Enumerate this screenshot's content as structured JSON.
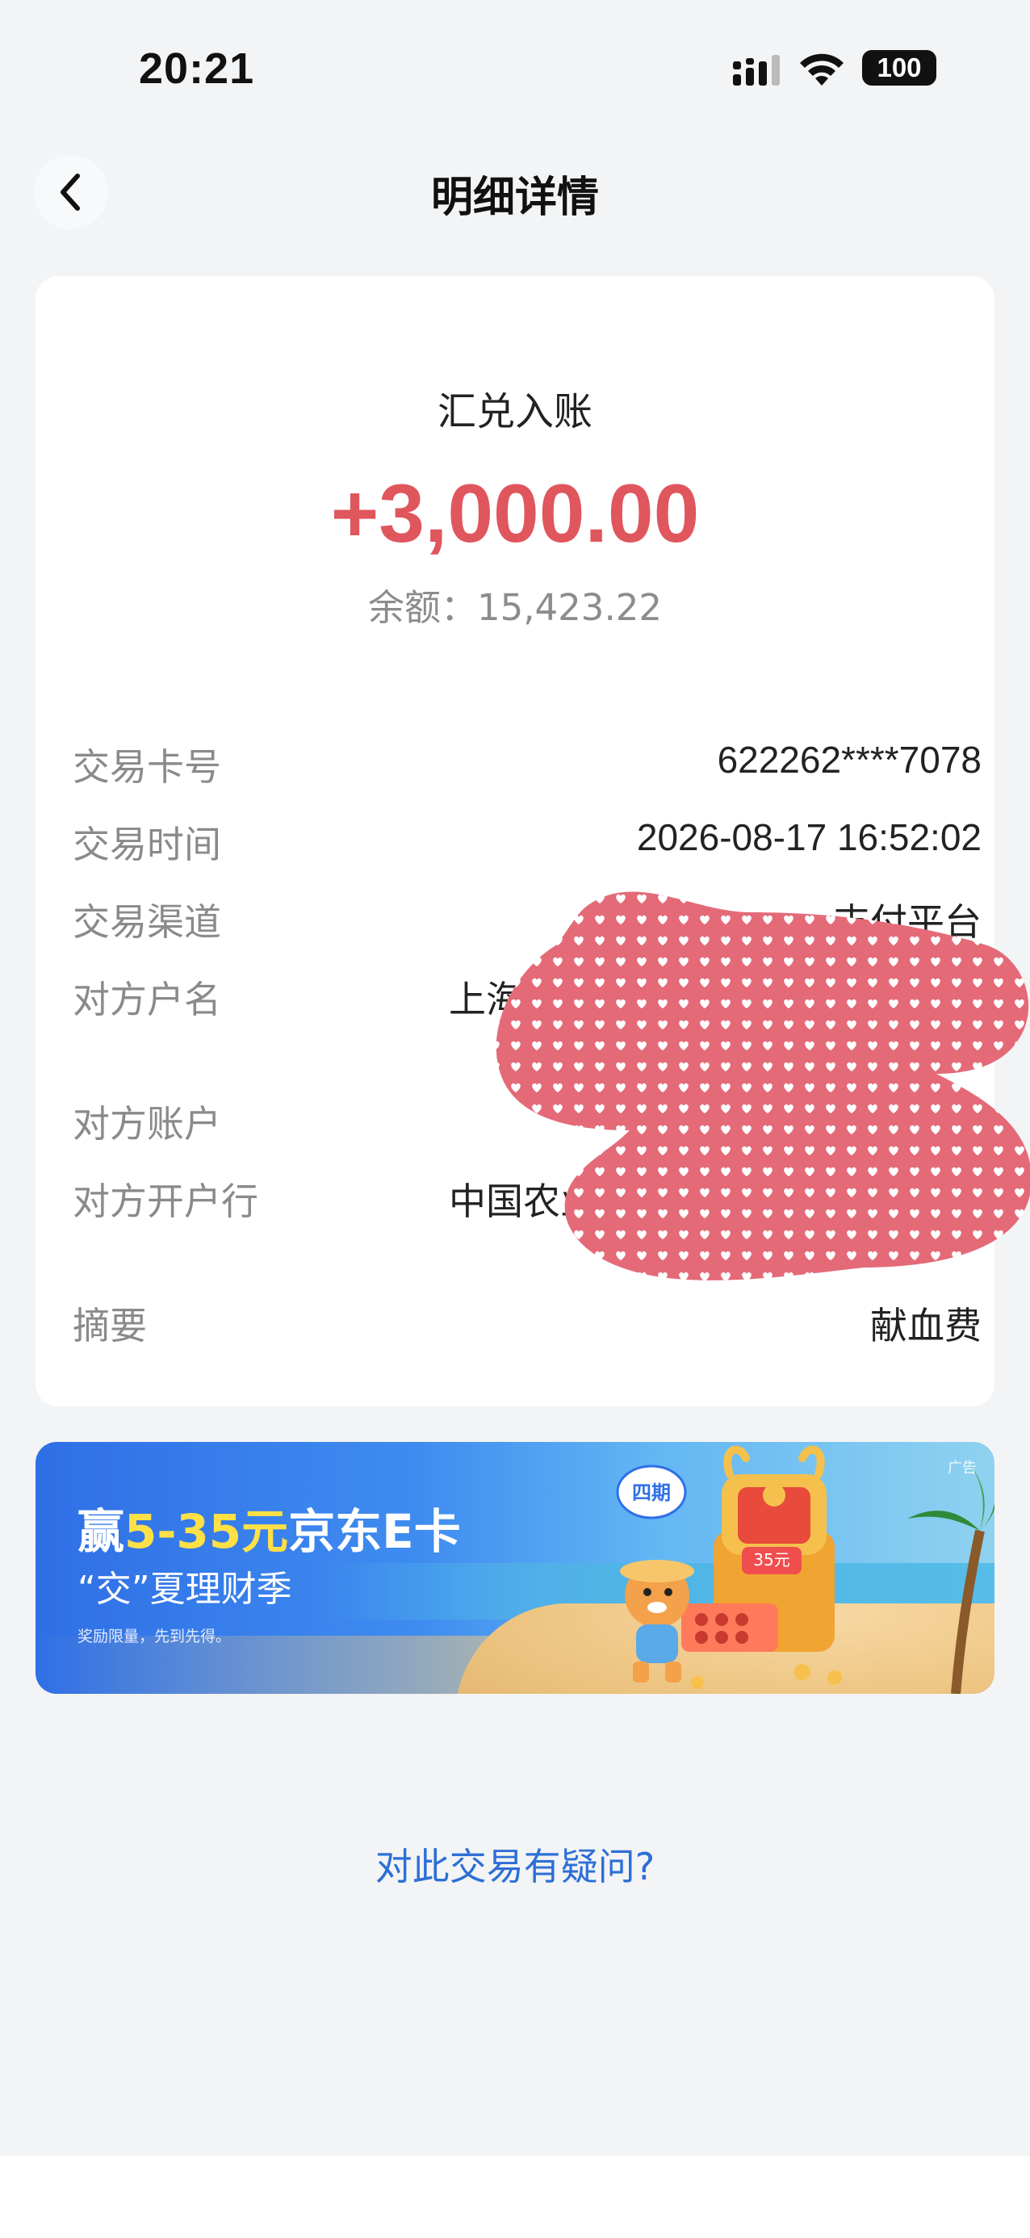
{
  "status_bar": {
    "time": "20:21",
    "battery": "100"
  },
  "nav": {
    "title": "明细详情"
  },
  "transaction": {
    "type": "汇兑入账",
    "amount": "+3,000.00",
    "balance": "余额：15,423.22",
    "amount_color": "#e0565d"
  },
  "details": [
    {
      "label": "交易卡号",
      "value": "622262****7078"
    },
    {
      "label": "交易时间",
      "value": "2026-08-17 16:52:02"
    },
    {
      "label": "交易渠道",
      "value": "支付平台"
    },
    {
      "label": "对方户名",
      "value": "上海市"
    },
    {
      "label": "对方账户",
      "value": ""
    },
    {
      "label": "对方开户行",
      "value": "中国农业银"
    },
    {
      "label": "摘要",
      "value": "献血费"
    }
  ],
  "banner": {
    "title_prefix": "赢",
    "title_highlight": "5-35元",
    "title_suffix": "京东E卡",
    "subtitle": "“交”夏理财季",
    "note": "奖励限量，先到先得。",
    "ad_tag": "广告",
    "badge": "四期",
    "coupon": "35元"
  },
  "question_link": "对此交易有疑问?",
  "colors": {
    "link": "#2d6fd6",
    "redact": "#e46a78",
    "background": "#f3f4f6"
  }
}
